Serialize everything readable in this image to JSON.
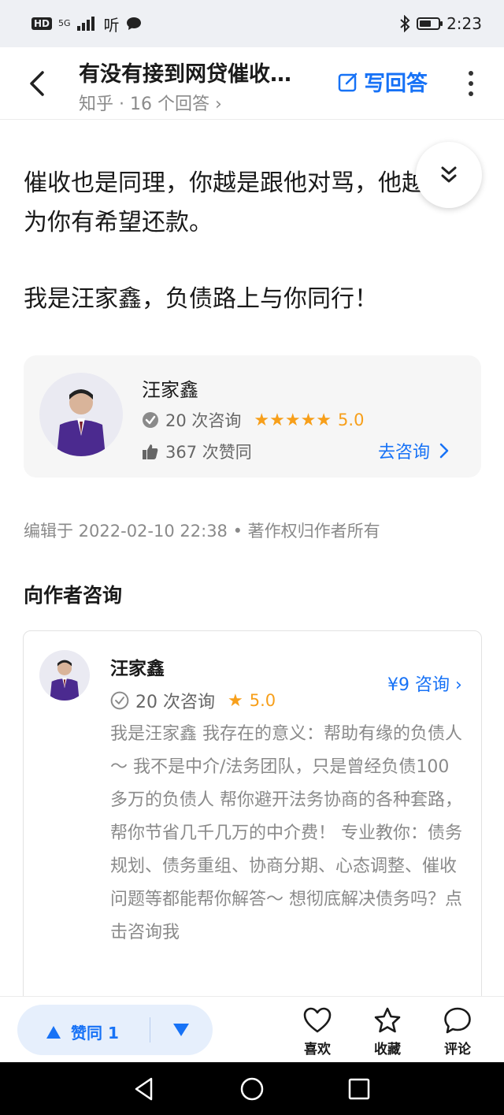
{
  "status_bar": {
    "left_badge": "HD",
    "network": "5G",
    "app_hint": "听",
    "time": "2:23"
  },
  "header": {
    "title": "有没有接到网贷催收…",
    "subtitle": "知乎 · 16 个回答 ›",
    "write_answer": "写回答"
  },
  "article": {
    "paragraph1": "催收也是同理，你越是跟他对骂，他越会认为你有希望还款。",
    "paragraph2": "我是汪家鑫，负债路上与你同行！"
  },
  "author_card": {
    "name": "汪家鑫",
    "consult_count": "20 次咨询",
    "stars": "★★★★★",
    "rating": "5.0",
    "likes": "367 次赞同",
    "consult_link": "去咨询"
  },
  "meta": {
    "edited": "编辑于 2022-02-10 22:38 • 著作权归作者所有"
  },
  "consult_section": {
    "title": "向作者咨询",
    "name": "汪家鑫",
    "price": "¥9 咨询 ›",
    "consult_count": "20 次咨询",
    "star": "★",
    "rating": "5.0",
    "description": "我是汪家鑫 我存在的意义：帮助有缘的负债人～ 我不是中介/法务团队，只是曾经负债100多万的负债人 帮你避开法务协商的各种套路， 帮你节省几千几万的中介费！ 专业教你：债务规划、债务重组、协商分期、心态调整、催收问题等都能帮你解答～ 想彻底解决债务吗？点击咨询我"
  },
  "action_bar": {
    "upvote": "赞同 1",
    "like": "喜欢",
    "favorite": "收藏",
    "comment": "评论"
  },
  "colors": {
    "accent": "#1772f6",
    "star": "#f79f1a",
    "vote_bg": "#e6effc"
  }
}
